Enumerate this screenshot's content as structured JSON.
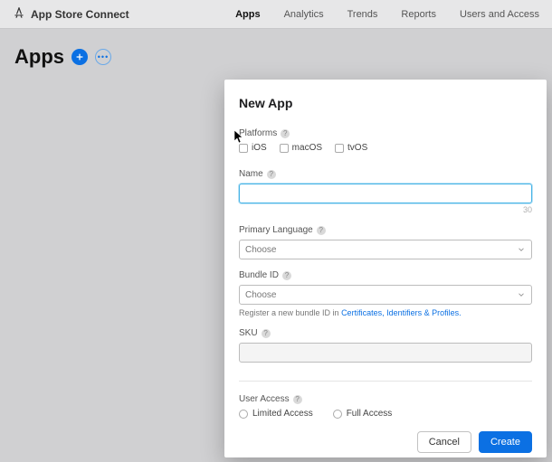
{
  "brand": "App Store Connect",
  "nav": {
    "apps": "Apps",
    "analytics": "Analytics",
    "trends": "Trends",
    "reports": "Reports",
    "users": "Users and Access"
  },
  "page": {
    "title": "Apps"
  },
  "modal": {
    "title": "New App",
    "platforms": {
      "label": "Platforms",
      "ios": "iOS",
      "macos": "macOS",
      "tvos": "tvOS"
    },
    "name": {
      "label": "Name",
      "value": "",
      "counter": "30"
    },
    "primaryLanguage": {
      "label": "Primary Language",
      "value": "Choose"
    },
    "bundleId": {
      "label": "Bundle ID",
      "value": "Choose",
      "hintPrefix": "Register a new bundle ID in ",
      "hintLink": "Certificates, Identifiers & Profiles."
    },
    "sku": {
      "label": "SKU",
      "value": ""
    },
    "userAccess": {
      "label": "User Access",
      "limited": "Limited Access",
      "full": "Full Access"
    },
    "buttons": {
      "cancel": "Cancel",
      "create": "Create"
    }
  }
}
